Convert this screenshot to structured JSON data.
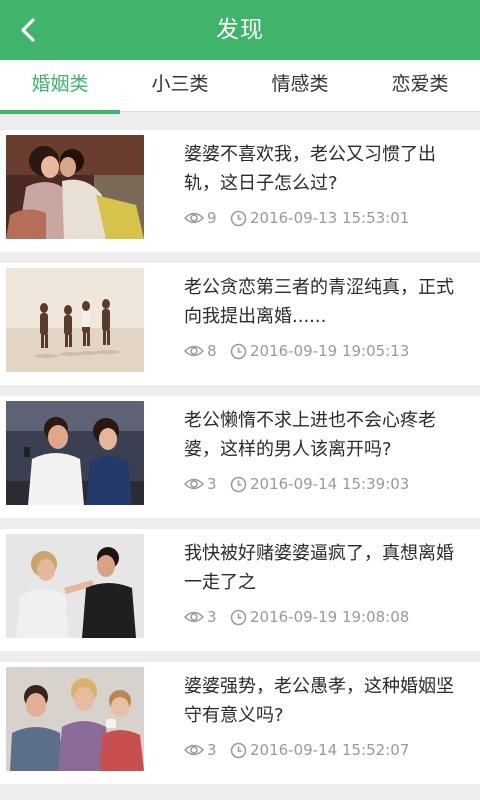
{
  "header": {
    "title": "发现",
    "back_icon": "chevron-left-icon",
    "color": "#3fb46a"
  },
  "tabs": [
    {
      "label": "婚姻类",
      "active": true
    },
    {
      "label": "小三类",
      "active": false
    },
    {
      "label": "情感类",
      "active": false
    },
    {
      "label": "恋爱类",
      "active": false
    }
  ],
  "articles": [
    {
      "title": "婆婆不喜欢我，老公又习惯了出轨，这日子怎么过?",
      "views": "9",
      "time": "2016-09-13 15:53:01",
      "image": "couple-kissing-photo"
    },
    {
      "title": "老公贪恋第三者的青涩纯真，正式向我提出离婚......",
      "views": "8",
      "time": "2016-09-19 19:05:13",
      "image": "beach-people-photo"
    },
    {
      "title": "老公懒惰不求上进也不会心疼老婆，这样的男人该离开吗?",
      "views": "3",
      "time": "2016-09-14 15:39:03",
      "image": "couple-on-phone-photo"
    },
    {
      "title": "我快被好赌婆婆逼疯了，真想离婚一走了之",
      "views": "3",
      "time": "2016-09-19 19:08:08",
      "image": "arguing-couple-photo"
    },
    {
      "title": "婆婆强势，老公愚孝，这种婚姻坚守有意义吗?",
      "views": "3",
      "time": "2016-09-14 15:52:07",
      "image": "family-group-photo"
    }
  ]
}
